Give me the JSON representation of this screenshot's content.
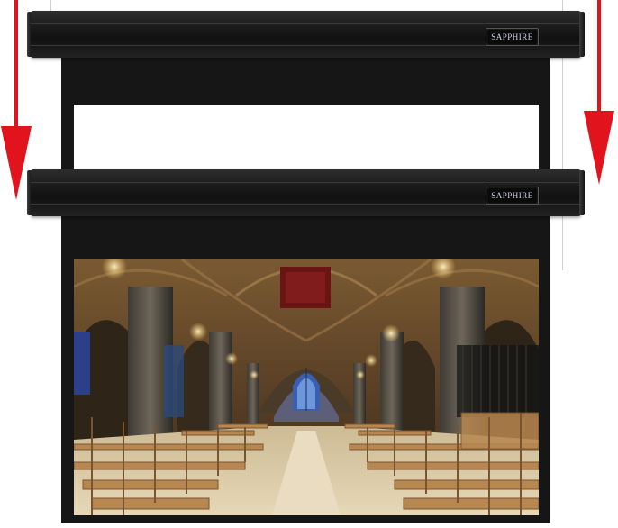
{
  "upper_unit": {
    "brand_badge": "SAPPHIRE"
  },
  "lower_unit": {
    "brand_badge": "SAPPHIRE"
  },
  "colors": {
    "arrow": "#e1141e",
    "casing": "#1a1a1a",
    "drop": "#151515",
    "screen_white": "#ffffff"
  },
  "icons": {
    "left": "arrow-down-icon",
    "right": "arrow-down-icon"
  }
}
